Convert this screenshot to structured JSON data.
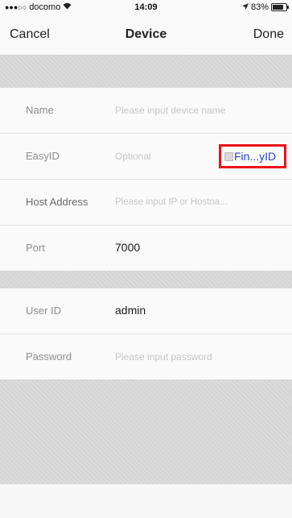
{
  "status_bar": {
    "carrier": "docomo",
    "time": "14:09",
    "battery": "83%",
    "battery_level": 0.83
  },
  "nav": {
    "cancel": "Cancel",
    "title": "Device",
    "done": "Done"
  },
  "form": {
    "name": {
      "label": "Name",
      "placeholder": "Please input device name"
    },
    "easyid": {
      "label": "EasyID",
      "placeholder": "Optional",
      "button": "Fin...yID"
    },
    "host": {
      "label": "Host Address",
      "placeholder": "Please input IP or Hostna..."
    },
    "port": {
      "label": "Port",
      "value": "7000"
    },
    "user": {
      "label": "User ID",
      "value": "admin"
    },
    "password": {
      "label": "Password",
      "placeholder": "Please input password"
    }
  },
  "colors": {
    "highlight_border": "#e8141a",
    "link_blue": "#2640c8",
    "separator": "#d4d4d4"
  }
}
